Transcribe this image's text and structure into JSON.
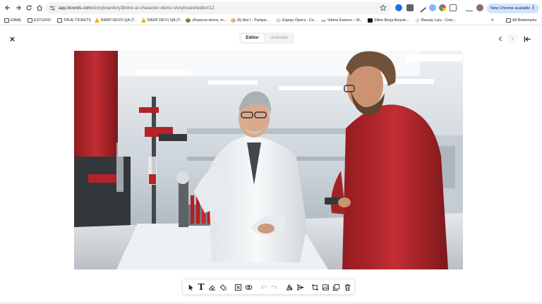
{
  "browser": {
    "url_host": "app.boords.com",
    "url_path": "/storyboards/y38xkw-ai-character-demo-storyboard/editor/12",
    "chrome_update_label": "New Chrome available",
    "bookmarks": [
      {
        "label": "EMAIL",
        "icon": "folder-icon"
      },
      {
        "label": "ESTUDIO",
        "icon": "folder-icon"
      },
      {
        "label": "TRUE TICKETS",
        "icon": "folder-icon"
      },
      {
        "label": "RADP DEVO QA (T...",
        "icon": "warning-icon"
      },
      {
        "label": "RADP DEV1 QA (T...",
        "icon": "warning-icon"
      },
      {
        "label": "¡Reserva ahora, m...",
        "icon": "site-icon"
      },
      {
        "label": "(6) Aivi I - Parque...",
        "icon": "site-icon"
      },
      {
        "label": "Espejo Ópera - Co...",
        "icon": "site-icon"
      },
      {
        "label": "Vitrina Esteros – M...",
        "icon": "site-icon"
      },
      {
        "label": "Sillon Borja Boucle...",
        "icon": "site-icon"
      },
      {
        "label": "Beauty Lulu - Com...",
        "icon": "site-icon"
      }
    ],
    "all_bookmarks_label": "All Bookmarks",
    "overflow_label": "»"
  },
  "editor": {
    "tabs": [
      {
        "label": "Editor",
        "active": true
      },
      {
        "label": "Animatic",
        "active": false
      }
    ],
    "frame_image_alt": "Scientist in white lab coat working at a laboratory bench with a colleague in a red jacket"
  },
  "toolbar": {
    "tools": [
      {
        "name": "select-tool",
        "icon": "cursor-icon",
        "enabled": true
      },
      {
        "name": "text-tool",
        "icon": "text-icon",
        "glyph": "T",
        "enabled": true
      },
      {
        "name": "eraser-tool",
        "icon": "eraser-icon",
        "enabled": true
      },
      {
        "name": "fill-tool",
        "icon": "paint-bucket-icon",
        "enabled": true
      },
      {
        "name": "clear-tool",
        "icon": "clear-frame-icon",
        "enabled": true
      },
      {
        "name": "shape-tool",
        "icon": "link-shapes-icon",
        "enabled": true
      },
      {
        "name": "undo-tool",
        "icon": "undo-icon",
        "enabled": false
      },
      {
        "name": "redo-tool",
        "icon": "redo-icon",
        "enabled": false
      },
      {
        "name": "flip-tool",
        "icon": "flip-icon",
        "enabled": true
      },
      {
        "name": "send-tool",
        "icon": "send-icon",
        "enabled": true
      },
      {
        "name": "crop-tool",
        "icon": "crop-icon",
        "enabled": true
      },
      {
        "name": "image-tool",
        "icon": "image-icon",
        "enabled": true
      },
      {
        "name": "duplicate-tool",
        "icon": "duplicate-icon",
        "enabled": true
      },
      {
        "name": "delete-tool",
        "icon": "trash-icon",
        "enabled": true
      }
    ]
  },
  "colors": {
    "accent_blue": "#d3e3fd",
    "lab_red": "#b01b1f",
    "lab_coat_white": "#eef1f3"
  }
}
